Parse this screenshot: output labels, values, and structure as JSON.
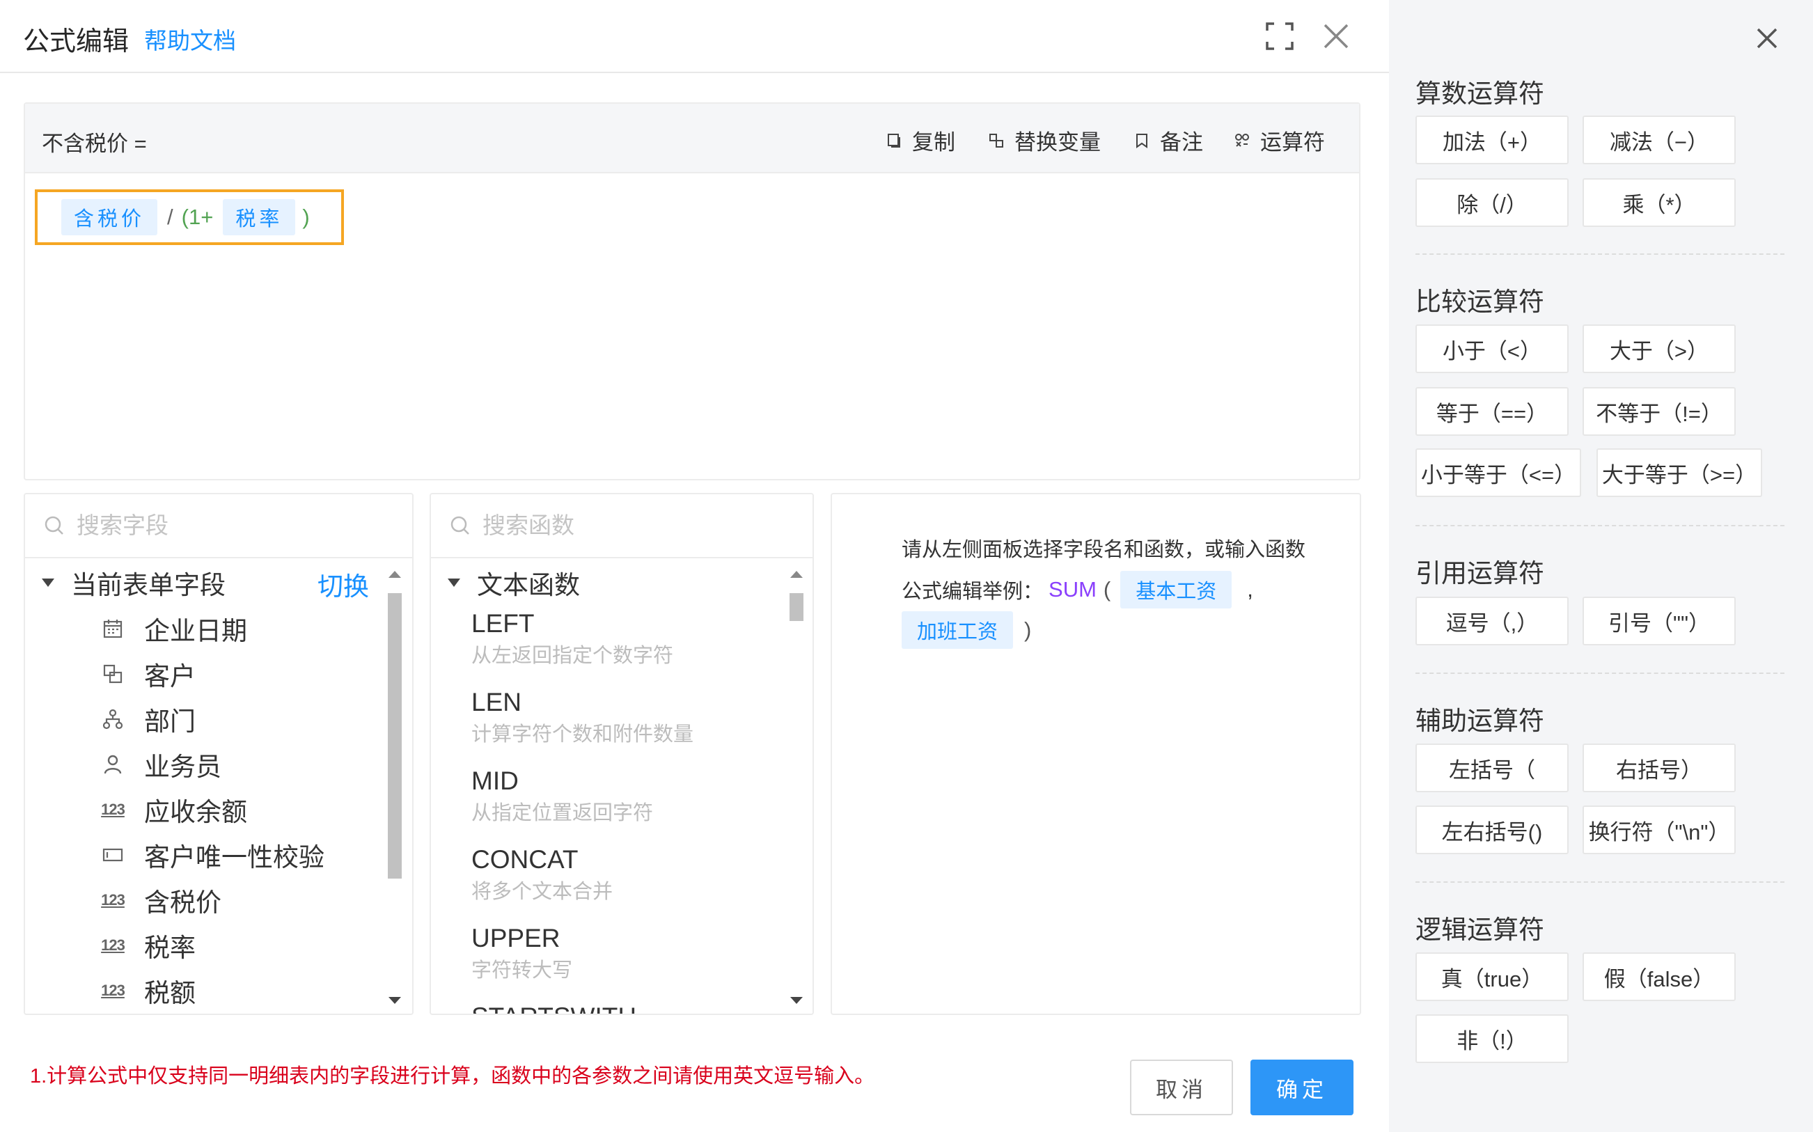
{
  "dialog": {
    "title": "公式编辑",
    "help_link": "帮助文档"
  },
  "editor": {
    "target_field": "不含税价 =",
    "toolbar": {
      "copy": "复制",
      "replace_var": "替换变量",
      "note": "备注",
      "operators": "运算符"
    },
    "formula": {
      "field1": "含税价",
      "op1": "/",
      "op2": "(1+",
      "field2": "税率",
      "op3": ")"
    }
  },
  "fields_panel": {
    "search_placeholder": "搜索字段",
    "group_label": "当前表单字段",
    "switch_label": "切换",
    "items": [
      {
        "label": "企业日期",
        "icon": "calendar-icon"
      },
      {
        "label": "客户",
        "icon": "customer-icon"
      },
      {
        "label": "部门",
        "icon": "org-tree-icon"
      },
      {
        "label": "业务员",
        "icon": "user-icon"
      },
      {
        "label": "应收余额",
        "icon": "number-icon"
      },
      {
        "label": "客户唯一性校验",
        "icon": "textbox-icon"
      },
      {
        "label": "含税价",
        "icon": "number-icon"
      },
      {
        "label": "税率",
        "icon": "number-icon"
      },
      {
        "label": "税额",
        "icon": "number-icon"
      }
    ]
  },
  "functions_panel": {
    "search_placeholder": "搜索函数",
    "group_label": "文本函数",
    "items": [
      {
        "name": "LEFT",
        "desc": "从左返回指定个数字符"
      },
      {
        "name": "LEN",
        "desc": "计算字符个数和附件数量"
      },
      {
        "name": "MID",
        "desc": "从指定位置返回字符"
      },
      {
        "name": "CONCAT",
        "desc": "将多个文本合并"
      },
      {
        "name": "UPPER",
        "desc": "字符转大写"
      },
      {
        "name": "STARTSWITH",
        "desc": ""
      }
    ]
  },
  "description_panel": {
    "hint": "请从左侧面板选择字段名和函数，或输入函数",
    "example_label": "公式编辑举例：",
    "example_fn": "SUM",
    "example_open": "(",
    "example_arg1": "基本工资",
    "example_comma": ",",
    "example_arg2": "加班工资",
    "example_close": ")"
  },
  "footer": {
    "note": "1.计算公式中仅支持同一明细表内的字段进行计算，函数中的各参数之间请使用英文逗号输入。",
    "cancel": "取消",
    "confirm": "确定"
  },
  "operators_panel": {
    "sections": [
      {
        "title": "算数运算符",
        "buttons": [
          "加法（+）",
          "减法（−）",
          "除（/）",
          "乘（*）"
        ]
      },
      {
        "title": "比较运算符",
        "buttons": [
          "小于（<）",
          "大于（>）",
          "等于（==）",
          "不等于（!=）",
          "小于等于（<=）",
          "大于等于（>=）"
        ]
      },
      {
        "title": "引用运算符",
        "buttons": [
          "逗号（,）",
          "引号（\"\"）"
        ]
      },
      {
        "title": "辅助运算符",
        "buttons": [
          "左括号（",
          "右括号）",
          "左右括号()",
          "换行符（\"\\n\"）"
        ]
      },
      {
        "title": "逻辑运算符",
        "buttons": [
          "真（true）",
          "假（false）",
          "非（!）"
        ]
      }
    ]
  },
  "colors": {
    "accent": "#1890ff",
    "highlight_border": "#f5a623",
    "error_text": "#d9001b",
    "primary_button": "#2d96f7",
    "function_name": "#8a3ffc"
  }
}
